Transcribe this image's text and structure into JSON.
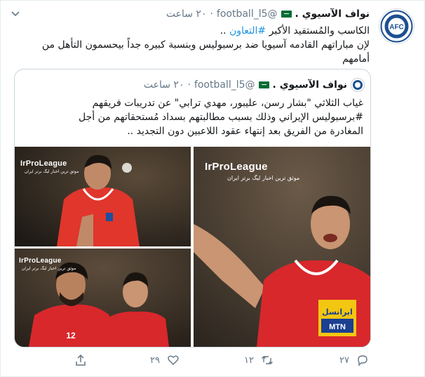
{
  "tweet": {
    "author_name": "نواف الآسيوي .",
    "handle": "@football_l5",
    "time": "٢٠ ساعت",
    "text_line1": "الكاسب والمُستفيد الأكبر",
    "hashtag": "#التعاون",
    "text_line1_end": "..",
    "text_line2": "لإن مباراتهم القادمه آسيويا ضد برسبوليس وبنسبة كبيره جداً بيحسمون التأهل من",
    "text_line3": "أمامهم",
    "avatar_label": "AFC"
  },
  "quoted": {
    "author_name": "نواف الآسيوي .",
    "handle": "@football_l5",
    "time": "٢٠ ساعت",
    "text_line1": "غياب الثلاثي \"بشار رسن، عليبور، مهدي ترابي\" عن تدريبات فريقهم",
    "text_line2": "#برسبوليس الإيراني وذلك بسبب مطالبتهم بسداد مُستحقاتهم من أجل",
    "text_line3": "المغادرة من الفريق بعد إنتهاء عقود اللاعبين دون التجديد ..",
    "media": {
      "logo": "IrProLeague",
      "logo_sub": "موثق ترین اخبار لیگ برتر ایران",
      "sponsor_top": "ایرانسل",
      "sponsor_bottom": "MTN",
      "shirt_number": "12"
    }
  },
  "actions": {
    "reply_count": "٢٧",
    "retweet_count": "١٢",
    "like_count": "٢٩",
    "share_icon": "share-icon"
  },
  "colors": {
    "link": "#1b95e0",
    "muted": "#657786",
    "border": "#ccd6dd"
  }
}
